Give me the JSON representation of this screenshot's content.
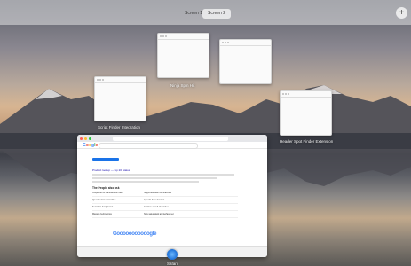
{
  "spaces": {
    "tabs": [
      {
        "label": "Screen 1"
      },
      {
        "label": "Screen 2"
      }
    ],
    "add_label": "+"
  },
  "windows": [
    {
      "label": "Ninja Spin Hit"
    },
    {
      "label": "Script Finder Integration"
    },
    {
      "label": "Header Spot Finder Extension"
    }
  ],
  "browser": {
    "logo": "Google",
    "section_title": "The People also ask",
    "pager": "Gooooooooooogle",
    "result_title": "Product lookup — top 20 Status",
    "paa_items": [
      "Unique set to manufacturer rate",
      "Supported nails manufacturer",
      "Question how is handled",
      "Agenda base hours in",
      "Search in Analyzer lot",
      "Continue result of number",
      "Manage before rows",
      "New sales stack at interface set"
    ]
  },
  "dock_app": {
    "label": "Safari"
  },
  "colors": {
    "accent": "#1a73e8",
    "link": "#1a0dab"
  }
}
